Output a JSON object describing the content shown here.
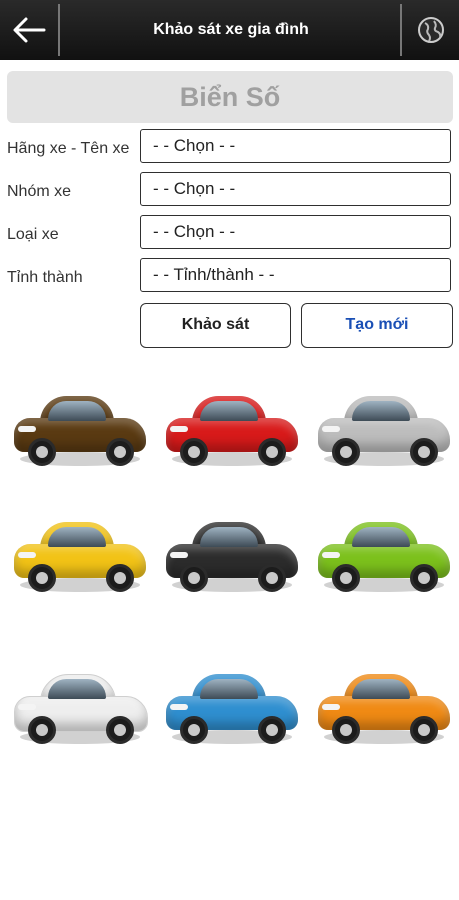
{
  "header": {
    "title": "Khảo sát xe gia đình",
    "back_icon": "back-arrow-icon",
    "globe_icon": "globe-icon"
  },
  "plate_label": "Biển Số",
  "form": {
    "brand_label": "Hãng xe - Tên xe",
    "brand_value": "- - Chọn - -",
    "group_label": "Nhóm xe",
    "group_value": "- - Chọn - -",
    "type_label": "Loại xe",
    "type_value": "- - Chọn - -",
    "province_label": "Tỉnh thành",
    "province_value": "- - Tỉnh/thành - -"
  },
  "buttons": {
    "survey": "Khảo sát",
    "create": "Tạo mới"
  },
  "cars": [
    {
      "color": "#5a3a12"
    },
    {
      "color": "#d81a1a"
    },
    {
      "color": "#bdbdbd"
    },
    {
      "color": "#f2c316"
    },
    {
      "color": "#2c2c2c"
    },
    {
      "color": "#7cc11c"
    },
    {
      "color": "#eeeeee"
    },
    {
      "color": "#2f8fd0"
    },
    {
      "color": "#f08a14"
    }
  ]
}
